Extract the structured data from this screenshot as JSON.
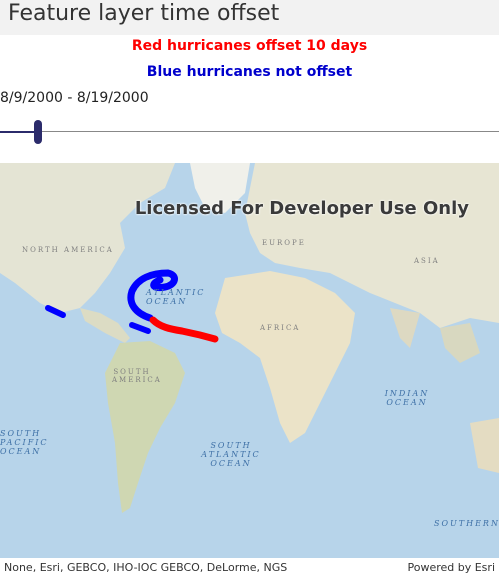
{
  "title": "Feature layer time offset",
  "legend": {
    "red": "Red hurricanes offset 10 days",
    "blue": "Blue hurricanes not offset"
  },
  "time_range_label": "8/9/2000 - 8/19/2000",
  "slider": {
    "position_fraction": 0.07
  },
  "map": {
    "watermark": "Licensed For Developer Use Only",
    "labels": {
      "north_america": "NORTH AMERICA",
      "europe": "EUROPE",
      "asia": "ASIA",
      "africa": "AFRICA",
      "south_america": "SOUTH AMERICA",
      "atlantic": "ATLANTIC OCEAN",
      "south_atlantic": "SOUTH ATLANTIC OCEAN",
      "indian": "INDIAN OCEAN",
      "south_pacific": "SOUTH PACIFIC OCEAN",
      "southern": "SOUTHERN O"
    },
    "colors": {
      "offset_track": "#ff0000",
      "not_offset_track": "#0000ff",
      "ocean": "#b7d4ea",
      "land": "#e9e6d4"
    }
  },
  "attribution": {
    "credits": "None, Esri, GEBCO, IHO-IOC GEBCO, DeLorme, NGS",
    "powered": "Powered by Esri"
  }
}
